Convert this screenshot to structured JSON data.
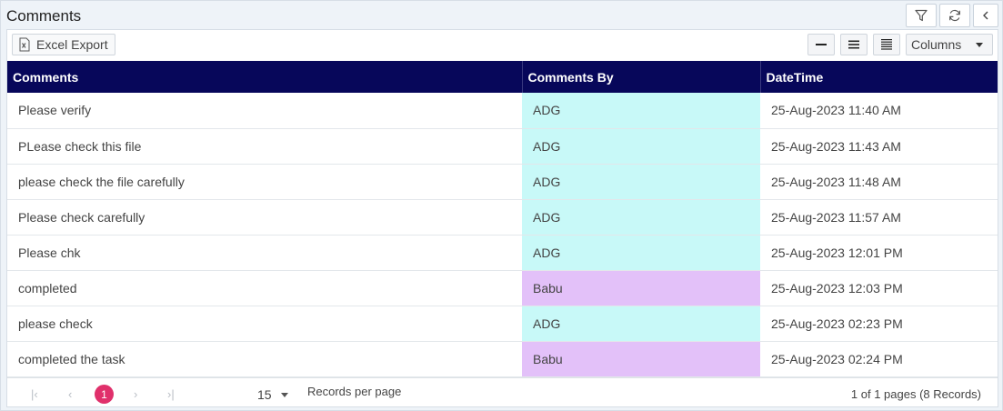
{
  "panel": {
    "title": "Comments"
  },
  "header_buttons": [
    {
      "name": "filter-button",
      "icon": "filter-icon"
    },
    {
      "name": "refresh-button",
      "icon": "refresh-icon"
    },
    {
      "name": "collapse-button",
      "icon": "chevron-left-icon"
    }
  ],
  "toolbar": {
    "excel_export_label": "Excel Export",
    "columns_label": "Columns",
    "density_icons": [
      "density-compact-icon",
      "density-normal-icon",
      "density-expanded-icon"
    ]
  },
  "table": {
    "headers": [
      "Comments",
      "Comments By",
      "DateTime"
    ],
    "rows": [
      {
        "comment": "Please verify",
        "by": "ADG",
        "datetime": "25-Aug-2023 11:40 AM",
        "by_color": "#c8f9f8"
      },
      {
        "comment": "PLease check this file",
        "by": "ADG",
        "datetime": "25-Aug-2023 11:43 AM",
        "by_color": "#c8f9f8"
      },
      {
        "comment": "please check the file carefully",
        "by": "ADG",
        "datetime": "25-Aug-2023 11:48 AM",
        "by_color": "#c8f9f8"
      },
      {
        "comment": "Please check carefully",
        "by": "ADG",
        "datetime": "25-Aug-2023 11:57 AM",
        "by_color": "#c8f9f8"
      },
      {
        "comment": "Please chk",
        "by": "ADG",
        "datetime": "25-Aug-2023 12:01 PM",
        "by_color": "#c8f9f8"
      },
      {
        "comment": "completed",
        "by": "Babu",
        "datetime": "25-Aug-2023 12:03 PM",
        "by_color": "#e3c1f9"
      },
      {
        "comment": "please check",
        "by": "ADG",
        "datetime": "25-Aug-2023 02:23 PM",
        "by_color": "#c8f9f8"
      },
      {
        "comment": "completed the task",
        "by": "Babu",
        "datetime": "25-Aug-2023 02:24 PM",
        "by_color": "#e3c1f9"
      }
    ]
  },
  "pager": {
    "current_page": "1",
    "page_size": "15",
    "records_per_page_label": "Records per page",
    "summary": "1 of 1 pages (8 Records)"
  },
  "colors": {
    "header_bg": "#07075a",
    "current_page": "#e0306b",
    "adg_row": "#c8f9f8",
    "babu_row": "#e3c1f9"
  }
}
